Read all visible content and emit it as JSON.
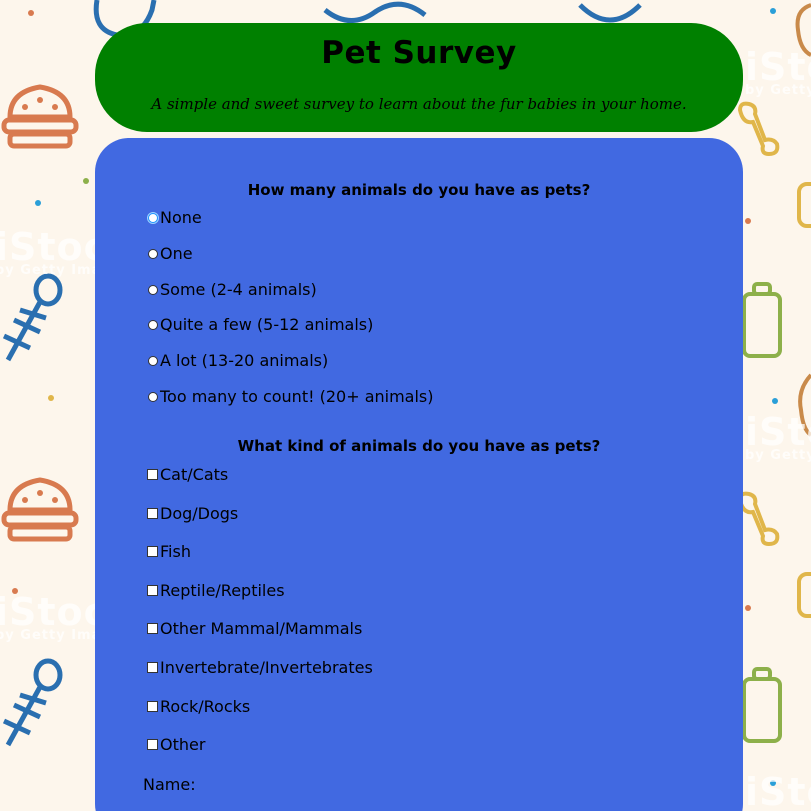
{
  "header": {
    "title": "Pet Survey",
    "subtitle": "A simple and sweet survey to learn about the fur babies in your home."
  },
  "q1": {
    "label": "How many animals do you have as pets?",
    "selected": "None",
    "options": [
      "None",
      "One",
      "Some (2-4 animals)",
      "Quite a few (5-12 animals)",
      "A lot (13-20 animals)",
      "Too many to count! (20+ animals)"
    ]
  },
  "q2": {
    "label": "What kind of animals do you have as pets?",
    "options": [
      "Cat/Cats",
      "Dog/Dogs",
      "Fish",
      "Reptile/Reptiles",
      "Other Mammal/Mammals",
      "Invertebrate/Invertebrates",
      "Rock/Rocks",
      "Other"
    ]
  },
  "name_field": {
    "label": "Name:"
  },
  "watermark": {
    "text": "iStock",
    "sub": "by Getty Images"
  },
  "colors": {
    "header_bg": "#008000",
    "card_bg": "#4169e1",
    "page_bg": "#fdf6ec"
  }
}
